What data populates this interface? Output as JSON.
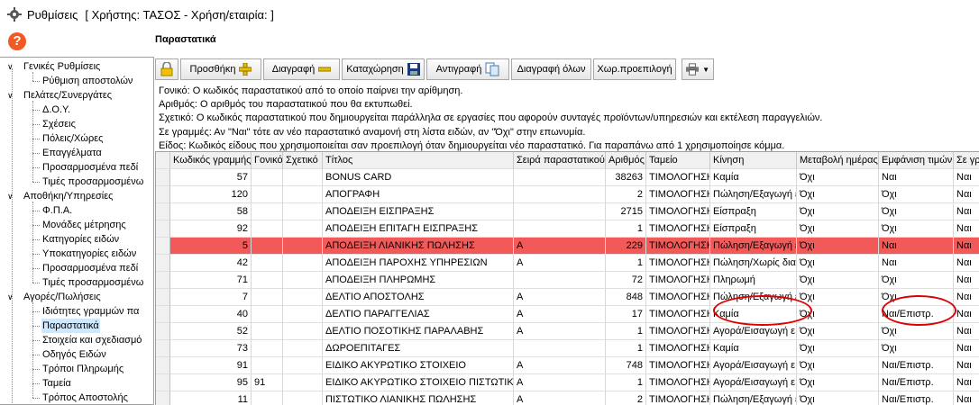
{
  "window": {
    "title": "Ρυθμίσεις",
    "user_info": "[ Χρήστης: ΤΑΣΟΣ - Χρήση/εταιρία: ]"
  },
  "section_title": "Παραστατικά",
  "sidebar": {
    "items": [
      {
        "label": "Γενικές Ρυθμίσεις",
        "level": 0,
        "toggle": "∨"
      },
      {
        "label": "Ρύθμιση αποστολών",
        "level": 1
      },
      {
        "label": "Πελάτες/Συνεργάτες",
        "level": 0,
        "toggle": "∨"
      },
      {
        "label": "Δ.Ο.Υ.",
        "level": 1
      },
      {
        "label": "Σχέσεις",
        "level": 1
      },
      {
        "label": "Πόλεις/Χώρες",
        "level": 1
      },
      {
        "label": "Επαγγέλματα",
        "level": 1
      },
      {
        "label": "Προσαρμοσμένα πεδί",
        "level": 1
      },
      {
        "label": "Τιμές προσαρμοσμένω",
        "level": 1
      },
      {
        "label": "Αποθήκη/Υπηρεσίες",
        "level": 0,
        "toggle": "∨"
      },
      {
        "label": "Φ.Π.Α.",
        "level": 1
      },
      {
        "label": "Μονάδες μέτρησης",
        "level": 1
      },
      {
        "label": "Κατηγορίες ειδών",
        "level": 1
      },
      {
        "label": "Υποκατηγορίες ειδών",
        "level": 1
      },
      {
        "label": "Προσαρμοσμένα πεδί",
        "level": 1
      },
      {
        "label": "Τιμές προσαρμοσμένω",
        "level": 1
      },
      {
        "label": "Αγορές/Πωλήσεις",
        "level": 0,
        "toggle": "∨"
      },
      {
        "label": "Ιδιότητες γραμμών πα",
        "level": 1
      },
      {
        "label": "Παραστατικά",
        "level": 1,
        "selected": true
      },
      {
        "label": "Στοιχεία και σχεδιασμό",
        "level": 1
      },
      {
        "label": "Οδηγός Ειδών",
        "level": 1
      },
      {
        "label": "Τρόποι Πληρωμής",
        "level": 1
      },
      {
        "label": "Ταμεία",
        "level": 1
      },
      {
        "label": "Τρόπος Αποστολής",
        "level": 1
      }
    ]
  },
  "toolbar": {
    "add": "Προσθήκη",
    "delete": "Διαγραφή",
    "save": "Καταχώρηση",
    "copy": "Αντιγραφή",
    "delete_all": "Διαγραφή όλων",
    "default_range": "Χωρ.προεπιλογή"
  },
  "info_lines": [
    "Γονικό: Ο κωδικός παραστατικού από το οποίο παίρνει την αρίθμηση.",
    "Αριθμός: Ο αριθμός του παραστατικού που θα εκτυπωθεί.",
    "Σχετικό: Ο κωδικός παραστατικού που δημιουργείται παράλληλα σε εργασίες που αφορούν συνταγές προϊόντων/υπηρεσιών και εκτέλεση παραγγελιών.",
    "Σε γραμμές: Αν \"Ναι\" τότε αν νέο παραστατικό αναμονή στη λίστα ειδών, αν \"Όχι\" στην επωνυμία.",
    "Είδος: Κωδικός είδους που χρησιμοποιείται σαν προεπιλογή όταν δημιουργείται νέο παραστατικό. Για παραπάνω από 1 χρησιμοποίησε κόμμα."
  ],
  "grid": {
    "columns": [
      "",
      "Κωδικός γραμμής",
      "Γονικό",
      "Σχετικό",
      "Τίτλος",
      "Σειρά παραστατικού",
      "Αριθμός",
      "Ταμείο",
      "Κίνηση",
      "Μεταβολή ημέρας",
      "Εμφάνιση τιμών",
      "Σε γρ"
    ],
    "rows": [
      [
        "",
        "57",
        "",
        "",
        "BONUS CARD",
        "",
        "38263",
        "ΤΙΜΟΛΟΓΗΣΗ",
        "Καμία",
        "Όχι",
        "Ναι",
        "Ναι"
      ],
      [
        "",
        "120",
        "",
        "",
        "ΑΠΟΓΡΑΦΗ",
        "",
        "2",
        "ΤΙΜΟΛΟΓΗΣΗ",
        "Πώληση/Εξαγωγή ε",
        "Όχι",
        "Όχι",
        "Ναι"
      ],
      [
        "",
        "58",
        "",
        "",
        "ΑΠΟΔΕΙΞΗ ΕΙΣΠΡΑΞΗΣ",
        "",
        "2715",
        "ΤΙΜΟΛΟΓΗΣΗ",
        "Είσπραξη",
        "Όχι",
        "Όχι",
        "Ναι"
      ],
      [
        "",
        "92",
        "",
        "",
        "ΑΠΟΔΕΙΞΗ ΕΠΙΤΑΓΗ ΕΙΣΠΡΑΞΗΣ",
        "",
        "1",
        "ΤΙΜΟΛΟΓΗΣΗ",
        "Είσπραξη",
        "Όχι",
        "Όχι",
        "Ναι"
      ],
      [
        "",
        "5",
        "",
        "",
        "ΑΠΟΔΕΙΞΗ ΛΙΑΝΙΚΗΣ ΠΩΛΗΣΗΣ",
        "A",
        "229",
        "ΤΙΜΟΛΟΓΗΣΗ",
        "Πώληση/Εξαγωγή ε",
        "Όχι",
        "Ναι",
        "Ναι"
      ],
      [
        "",
        "42",
        "",
        "",
        "ΑΠΟΔΕΙΞΗ ΠΑΡΟΧΗΣ ΥΠΗΡΕΣΙΩΝ",
        "A",
        "1",
        "ΤΙΜΟΛΟΓΗΣΗ",
        "Πώληση/Χωρίς διαι",
        "Όχι",
        "Ναι",
        "Ναι"
      ],
      [
        "",
        "71",
        "",
        "",
        "ΑΠΟΔΕΙΞΗ ΠΛΗΡΩΜΗΣ",
        "",
        "72",
        "ΤΙΜΟΛΟΓΗΣΗ",
        "Πληρωμή",
        "Όχι",
        "Όχι",
        "Ναι"
      ],
      [
        "",
        "7",
        "",
        "",
        "ΔΕΛΤΙΟ ΑΠΟΣΤΟΛΗΣ",
        "A",
        "848",
        "ΤΙΜΟΛΟΓΗΣΗ",
        "Πώληση/Εξαγωγή ε",
        "Όχι",
        "Όχι",
        "Ναι"
      ],
      [
        "",
        "40",
        "",
        "",
        "ΔΕΛΤΙΟ ΠΑΡΑΓΓΕΛΙΑΣ",
        "A",
        "17",
        "ΤΙΜΟΛΟΓΗΣΗ",
        "Καμία",
        "Όχι",
        "Ναι/Επιστρ.",
        "Ναι"
      ],
      [
        "",
        "52",
        "",
        "",
        "ΔΕΛΤΙΟ ΠΟΣΟΤΙΚΗΣ ΠΑΡΑΛΑΒΗΣ",
        "A",
        "1",
        "ΤΙΜΟΛΟΓΗΣΗ",
        "Αγορά/Εισαγωγή ε",
        "Όχι",
        "Όχι",
        "Ναι"
      ],
      [
        "",
        "73",
        "",
        "",
        "ΔΩΡΟΕΠΙΤΑΓΕΣ",
        "",
        "1",
        "ΤΙΜΟΛΟΓΗΣΗ",
        "Καμία",
        "Όχι",
        "Όχι",
        "Ναι"
      ],
      [
        "",
        "91",
        "",
        "",
        "ΕΙΔΙΚΟ ΑΚΥΡΩΤΙΚΟ ΣΤΟΙΧΕΙΟ",
        "A",
        "748",
        "ΤΙΜΟΛΟΓΗΣΗ",
        "Αγορά/Εισαγωγή ε",
        "Όχι",
        "Ναι/Επιστρ.",
        "Ναι"
      ],
      [
        "",
        "95",
        "91",
        "",
        "ΕΙΔΙΚΟ ΑΚΥΡΩΤΙΚΟ ΣΤΟΙΧΕΙΟ ΠΙΣΤΩΤΙΚΟ",
        "A",
        "1",
        "ΤΙΜΟΛΟΓΗΣΗ",
        "Αγορά/Εισαγωγή ε",
        "Όχι",
        "Ναι/Επιστρ.",
        "Ναι"
      ],
      [
        "",
        "11",
        "",
        "",
        "ΠΙΣΤΩΤΙΚΟ ΛΙΑΝΙΚΗΣ ΠΩΛΗΣΗΣ",
        "A",
        "2",
        "ΤΙΜΟΛΟΓΗΣΗ",
        "Πώληση/Εξαγωγή ε",
        "Όχι",
        "Ναι/Επιστρ.",
        "Ναι"
      ]
    ],
    "highlight_row": 4
  },
  "colors": {
    "highlight_row": "#f25a5a",
    "annotation_ellipse": "#e00000",
    "help_icon": "#f15a22",
    "selection": "#cde8ff"
  }
}
